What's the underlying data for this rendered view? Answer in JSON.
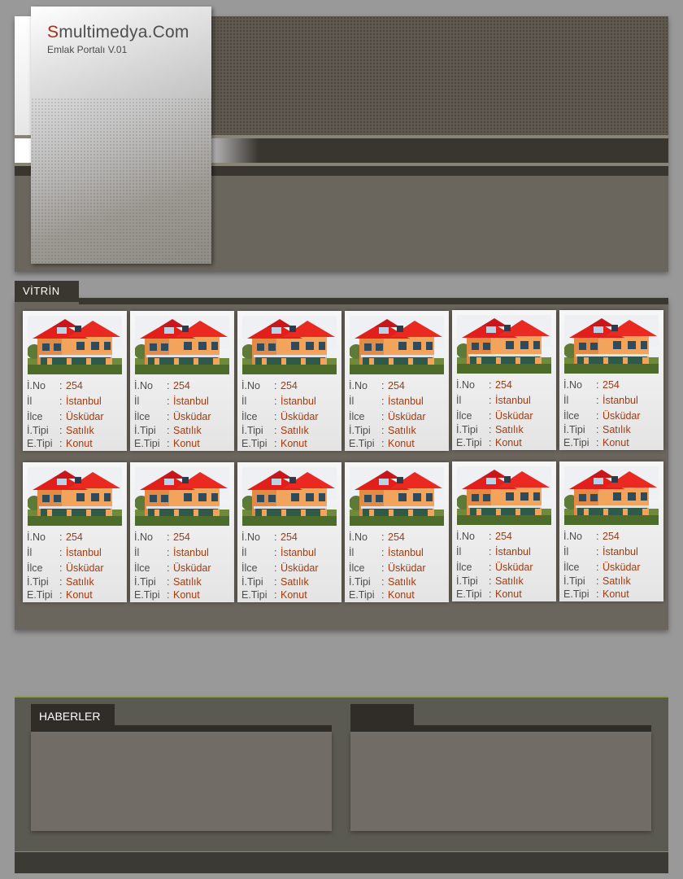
{
  "site": {
    "title_first": "S",
    "title_rest": "multimedya.Com",
    "subtitle": "Emlak Portalı V.01"
  },
  "vitrin": {
    "label": "VİTRİN",
    "field_labels": [
      "İ.No",
      "İl",
      "İlce",
      "İ.Tipi",
      "E.Tipi"
    ],
    "separator": ":",
    "listings": [
      {
        "values": [
          "254",
          "İstanbul",
          "Üsküdar",
          "Satılık",
          "Konut"
        ]
      },
      {
        "values": [
          "254",
          "İstanbul",
          "Üsküdar",
          "Satılık",
          "Konut"
        ]
      },
      {
        "values": [
          "254",
          "İstanbul",
          "Üsküdar",
          "Satılık",
          "Konut"
        ]
      },
      {
        "values": [
          "254",
          "İstanbul",
          "Üsküdar",
          "Satılık",
          "Konut"
        ]
      },
      {
        "values": [
          "254",
          "İstanbul",
          "Üsküdar",
          "Satılık",
          "Konut"
        ]
      },
      {
        "values": [
          "254",
          "İstanbul",
          "Üsküdar",
          "Satılık",
          "Konut"
        ]
      },
      {
        "values": [
          "254",
          "İstanbul",
          "Üsküdar",
          "Satılık",
          "Konut"
        ]
      },
      {
        "values": [
          "254",
          "İstanbul",
          "Üsküdar",
          "Satılık",
          "Konut"
        ]
      },
      {
        "values": [
          "254",
          "İstanbul",
          "Üsküdar",
          "Satılık",
          "Konut"
        ]
      },
      {
        "values": [
          "254",
          "İstanbul",
          "Üsküdar",
          "Satılık",
          "Konut"
        ]
      },
      {
        "values": [
          "254",
          "İstanbul",
          "Üsküdar",
          "Satılık",
          "Konut"
        ]
      },
      {
        "values": [
          "254",
          "İstanbul",
          "Üsküdar",
          "Satılık",
          "Konut"
        ]
      }
    ]
  },
  "news": {
    "label": "HABERLER"
  },
  "colors": {
    "accent_red": "#a62c16",
    "value_text": "#a13b10",
    "dark_bar": "#3a3630",
    "panel_bg": "#716c65",
    "bottom_border": "#8fa04a"
  },
  "icons": {
    "listing_photo": "house-photo"
  }
}
